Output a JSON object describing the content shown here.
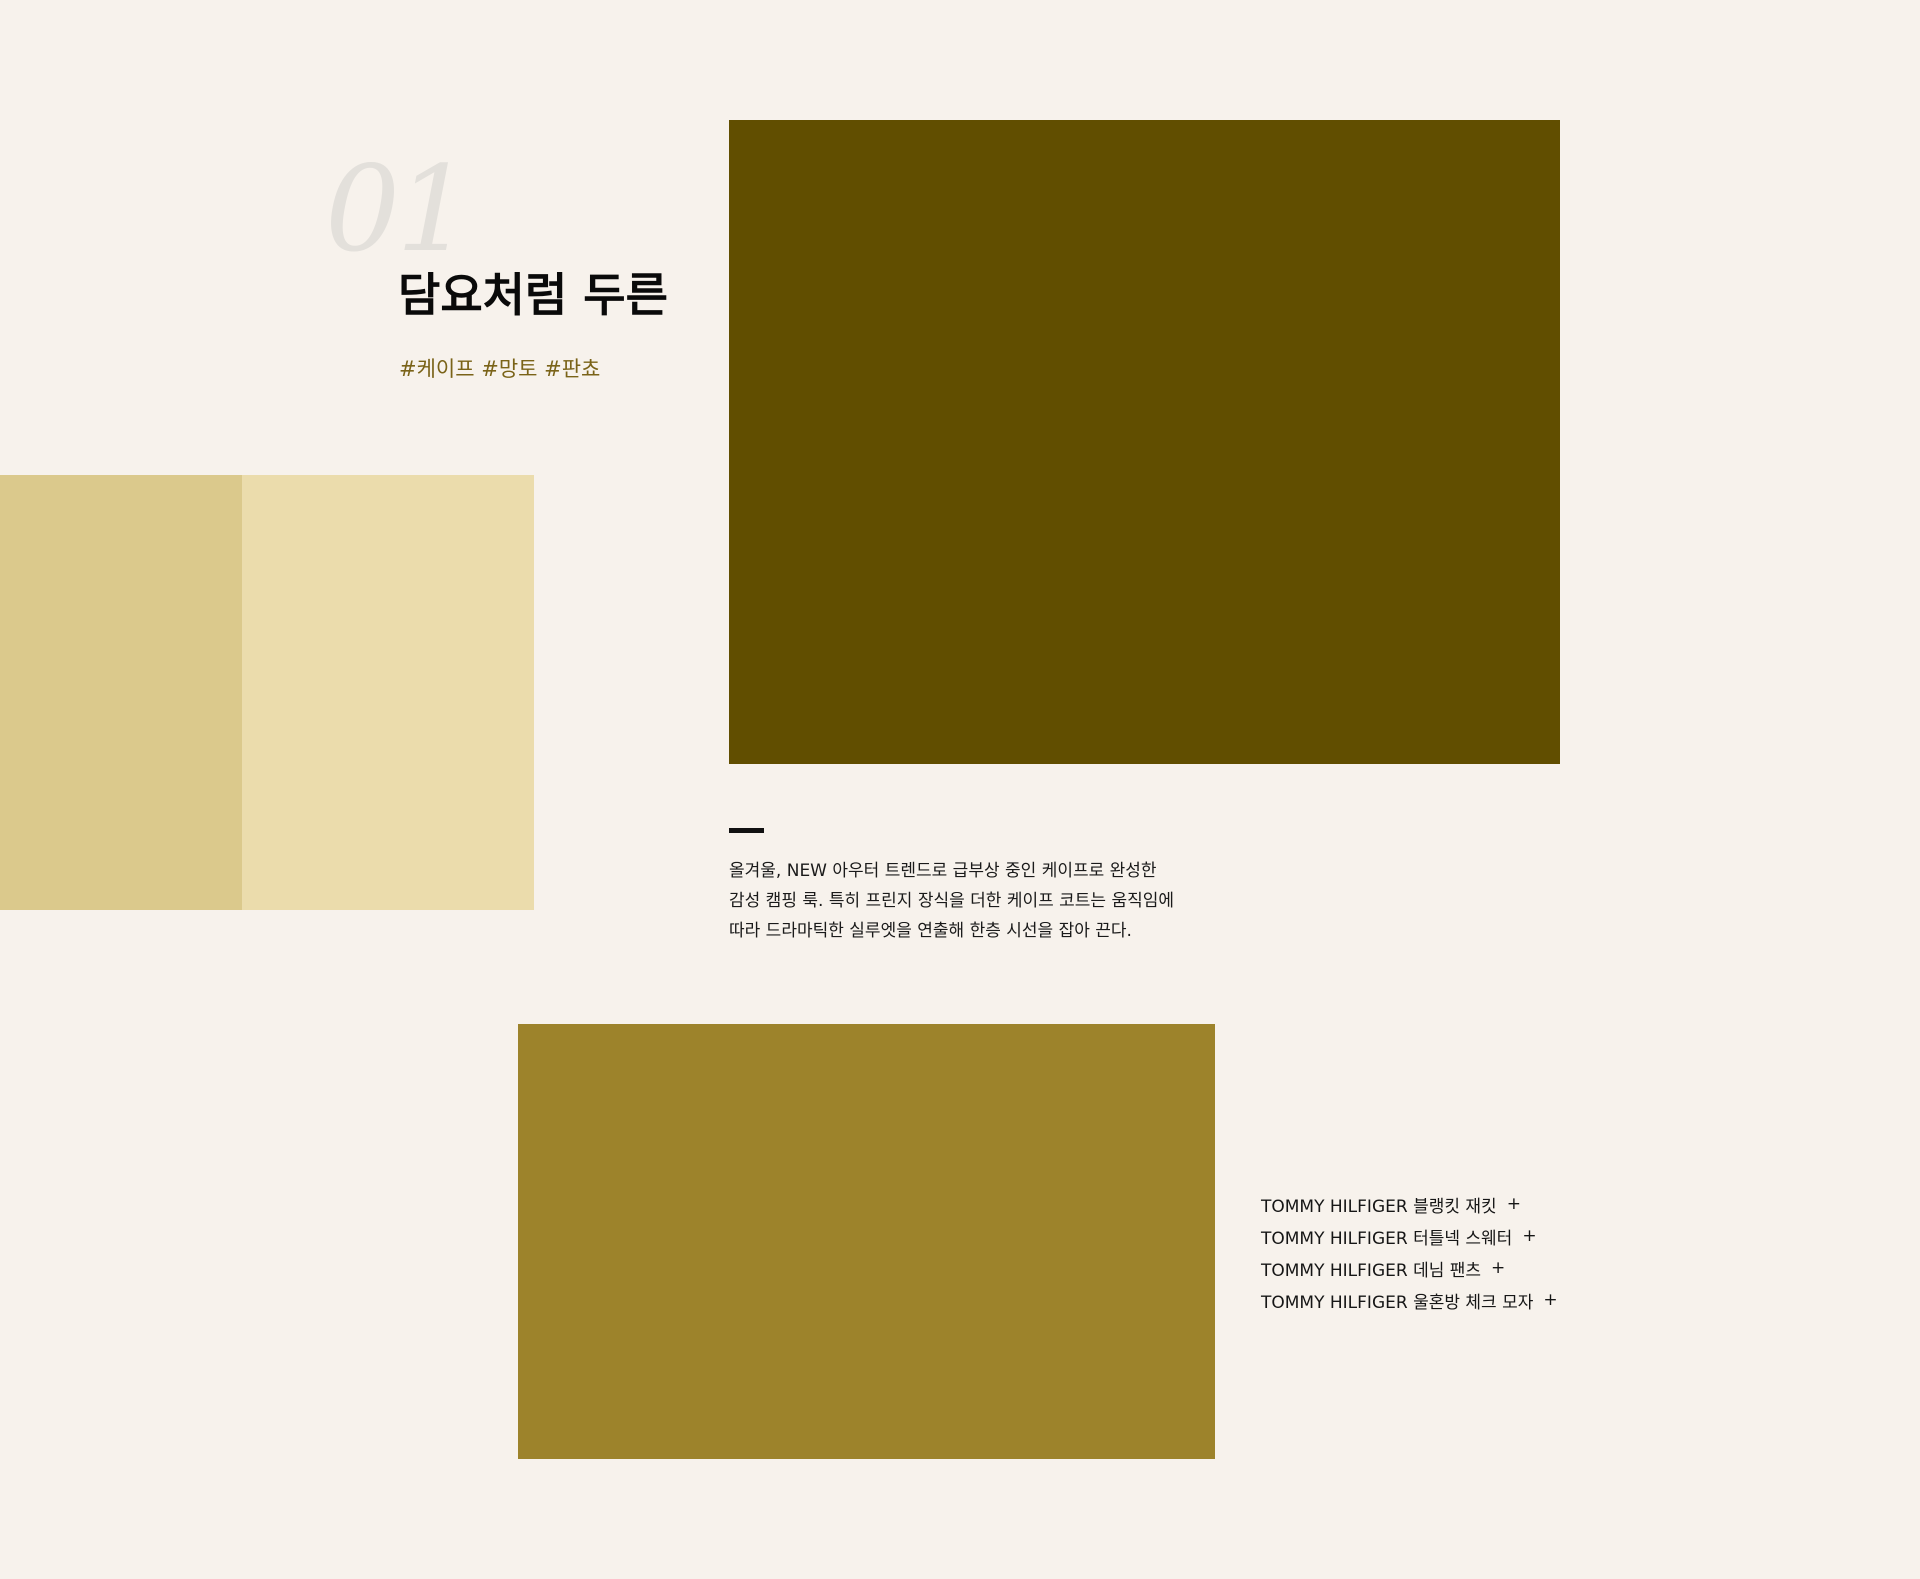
{
  "section": {
    "number": "01",
    "title": "담요처럼 두른",
    "hashtags": "#케이프 #망토 #판쵸"
  },
  "colors": {
    "background": "#f7f2ec",
    "hero_image": "#614e00",
    "left_swatch_a": "#dbc98c",
    "left_swatch_b": "#ebdcac",
    "lower_image": "#9d832b",
    "hashtag": "#7a6318"
  },
  "description": {
    "lines": [
      "올겨울, NEW 아우터 트렌드로 급부상 중인 케이프로 완성한",
      "감성 캠핑 룩. 특히 프린지 장식을 더한 케이프 코트는 움직임에",
      "따라 드라마틱한 실루엣을 연출해 한층 시선을 잡아 끈다."
    ]
  },
  "products": {
    "items": [
      {
        "label": "TOMMY HILFIGER 블랭킷 재킷",
        "icon": "plus-icon",
        "symbol": "+"
      },
      {
        "label": "TOMMY HILFIGER 터틀넥 스웨터",
        "icon": "plus-icon",
        "symbol": "+"
      },
      {
        "label": "TOMMY HILFIGER 데님 팬츠",
        "icon": "plus-icon",
        "symbol": "+"
      },
      {
        "label": "TOMMY HILFIGER 울혼방 체크 모자",
        "icon": "plus-icon",
        "symbol": "+"
      }
    ]
  }
}
